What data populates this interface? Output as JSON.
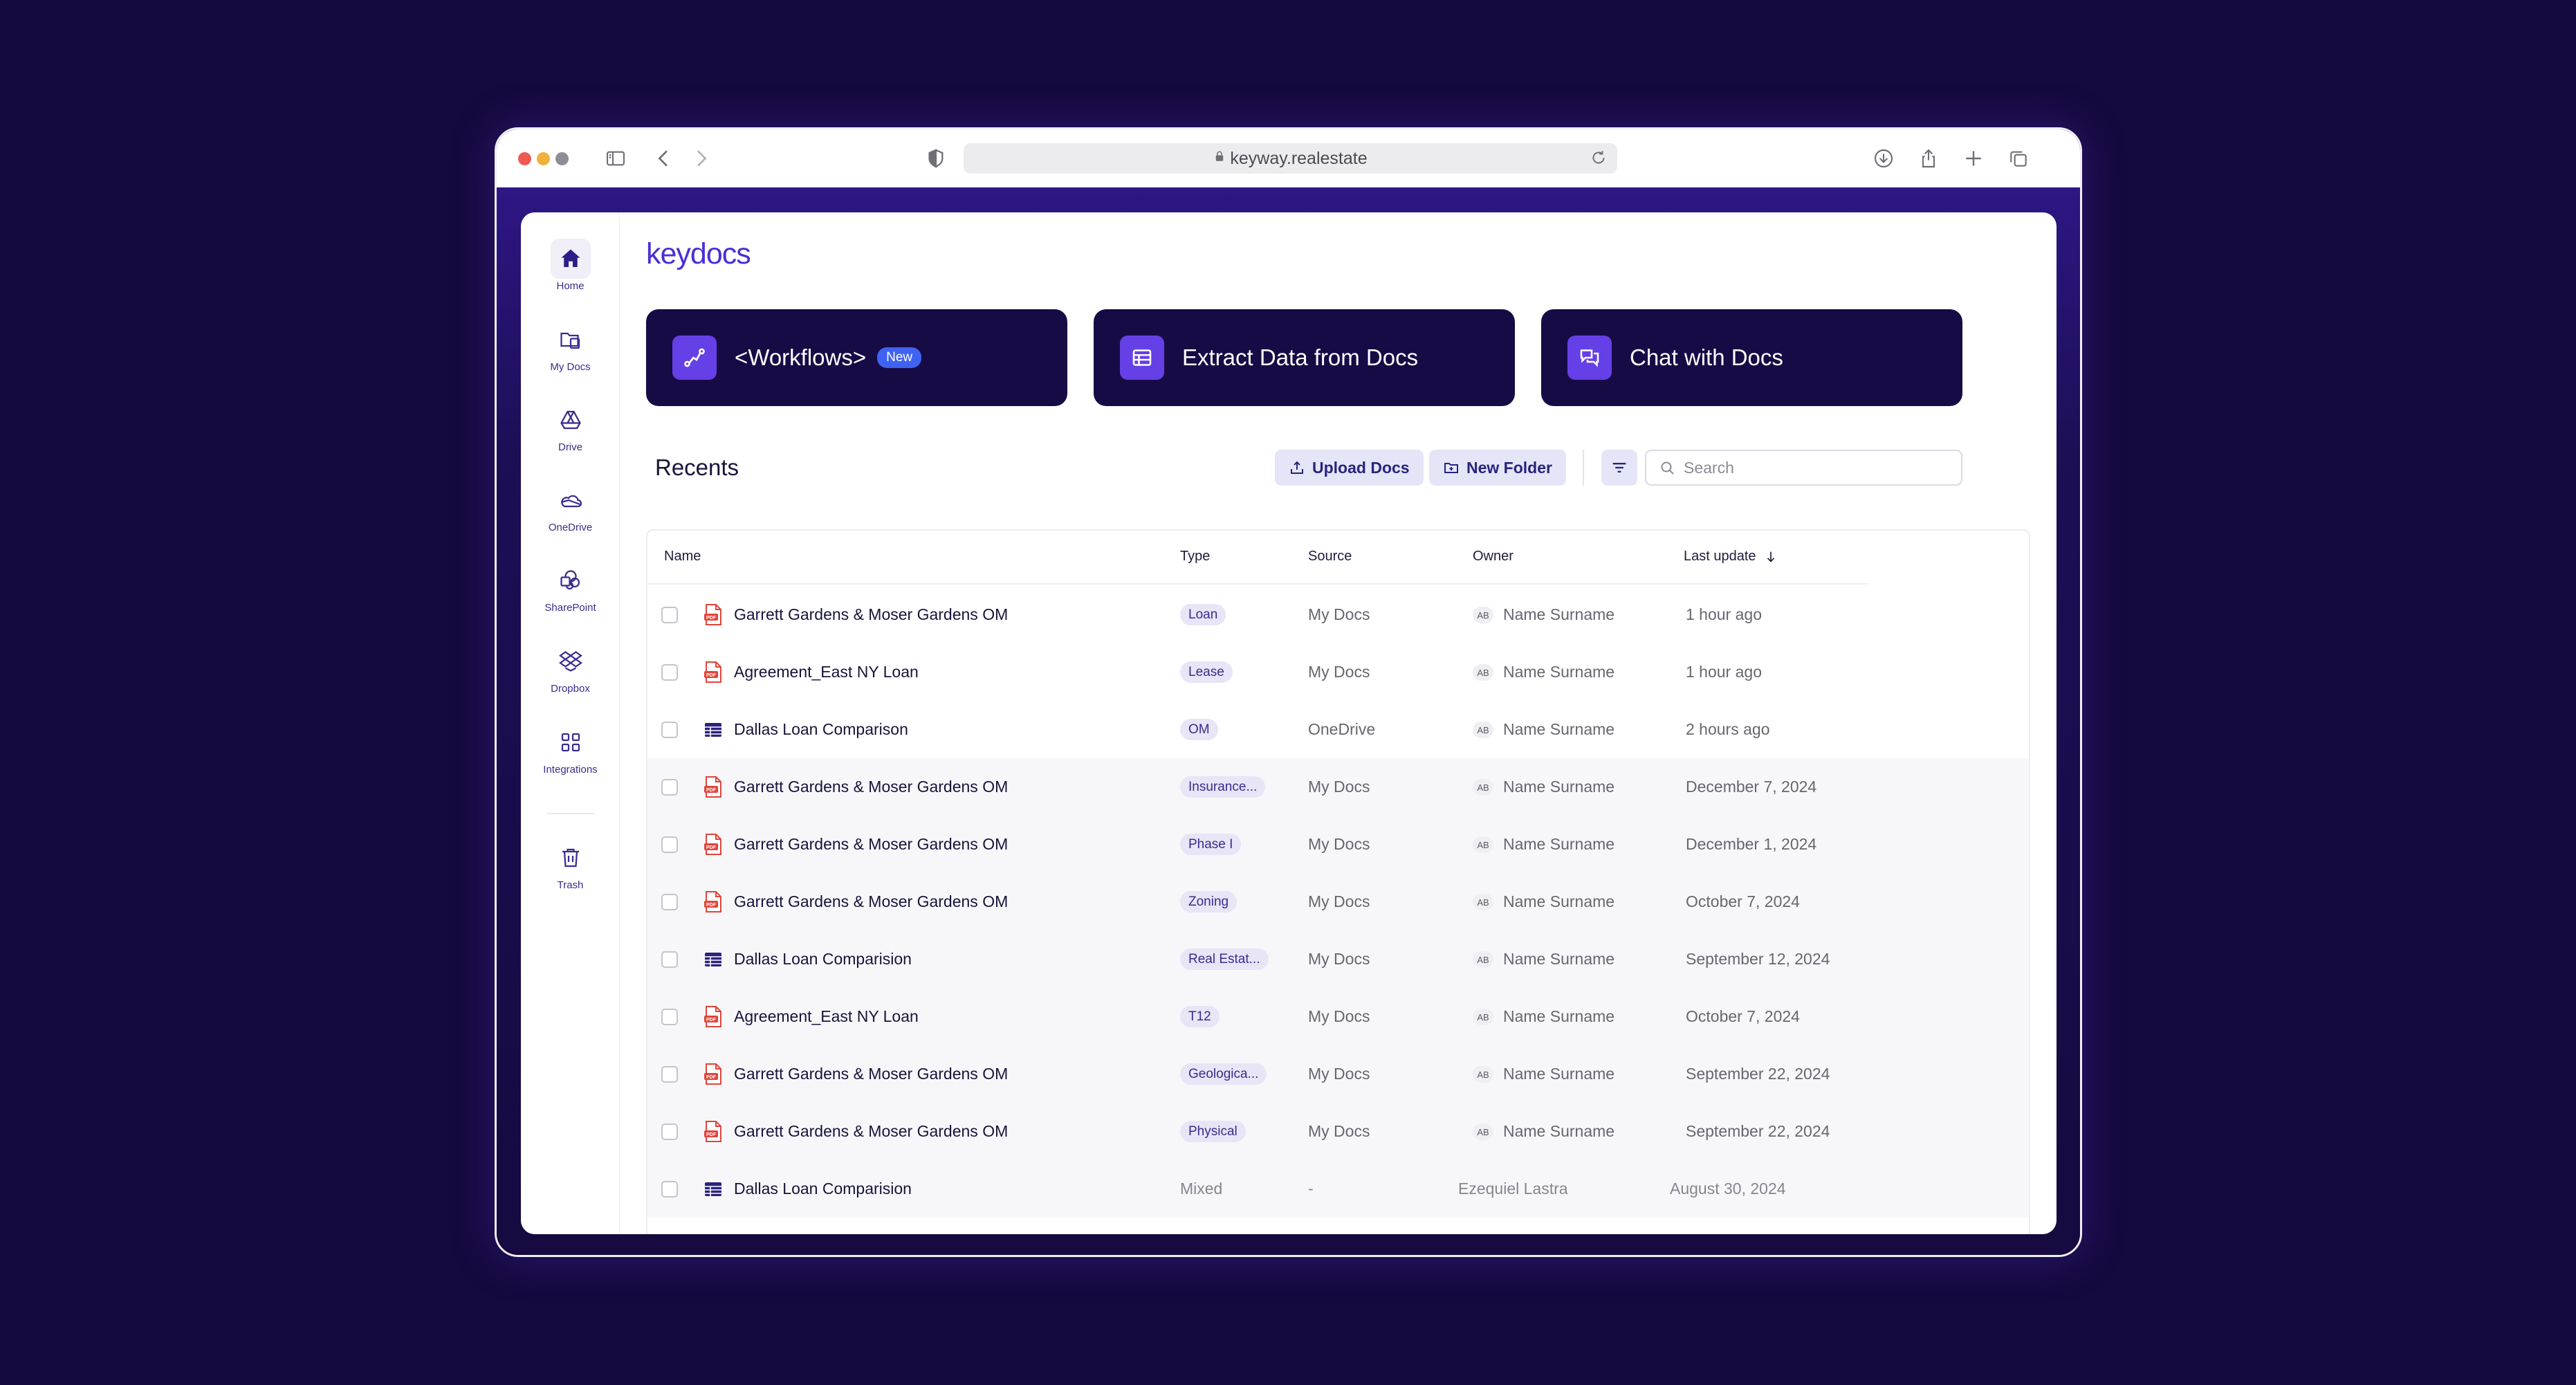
{
  "browser": {
    "url": "keyway.realestate"
  },
  "app": {
    "logo": "keydocs"
  },
  "sidebar": {
    "items": [
      {
        "label": "Home",
        "icon": "home-icon"
      },
      {
        "label": "My Docs",
        "icon": "my-docs-icon"
      },
      {
        "label": "Drive",
        "icon": "drive-icon"
      },
      {
        "label": "OneDrive",
        "icon": "onedrive-icon"
      },
      {
        "label": "SharePoint",
        "icon": "sharepoint-icon"
      },
      {
        "label": "Dropbox",
        "icon": "dropbox-icon"
      },
      {
        "label": "Integrations",
        "icon": "integrations-icon"
      },
      {
        "label": "Trash",
        "icon": "trash-icon"
      }
    ]
  },
  "cards": [
    {
      "title": "<Workflows>",
      "badge": "New",
      "icon": "workflow-icon"
    },
    {
      "title": "Extract Data from Docs",
      "icon": "table-icon"
    },
    {
      "title": "Chat with Docs",
      "icon": "chat-icon"
    }
  ],
  "recents": {
    "title": "Recents",
    "upload_label": "Upload Docs",
    "new_folder_label": "New Folder",
    "search_placeholder": "Search"
  },
  "table": {
    "columns": [
      "Name",
      "Type",
      "Source",
      "Owner",
      "Last update"
    ],
    "rows": [
      {
        "name": "Garrett Gardens & Moser Gardens OM",
        "file": "pdf",
        "type": "Loan",
        "source": "My Docs",
        "initials": "AB",
        "owner": "Name Surname",
        "updated": "1 hour ago"
      },
      {
        "name": "Agreement_East NY Loan",
        "file": "pdf",
        "type": "Lease",
        "source": "My Docs",
        "initials": "AB",
        "owner": "Name Surname",
        "updated": "1 hour ago"
      },
      {
        "name": "Dallas Loan Comparison",
        "file": "sheet",
        "type": "OM",
        "source": "OneDrive",
        "initials": "AB",
        "owner": "Name Surname",
        "updated": "2 hours ago"
      },
      {
        "name": "Garrett Gardens & Moser Gardens OM",
        "file": "pdf",
        "type": "Insurance...",
        "source": "My Docs",
        "initials": "AB",
        "owner": "Name Surname",
        "updated": "December 7, 2024"
      },
      {
        "name": "Garrett Gardens & Moser Gardens OM",
        "file": "pdf",
        "type": "Phase I",
        "source": "My Docs",
        "initials": "AB",
        "owner": "Name Surname",
        "updated": "December 1, 2024"
      },
      {
        "name": "Garrett Gardens & Moser Gardens OM",
        "file": "pdf",
        "type": "Zoning",
        "source": "My Docs",
        "initials": "AB",
        "owner": "Name Surname",
        "updated": "October 7, 2024"
      },
      {
        "name": "Dallas Loan Comparision",
        "file": "sheet",
        "type": "Real Estat...",
        "source": "My Docs",
        "initials": "AB",
        "owner": "Name Surname",
        "updated": "September 12, 2024"
      },
      {
        "name": "Agreement_East NY Loan",
        "file": "pdf",
        "type": "T12",
        "source": "My Docs",
        "initials": "AB",
        "owner": "Name Surname",
        "updated": "October 7, 2024"
      },
      {
        "name": "Garrett Gardens & Moser Gardens OM",
        "file": "pdf",
        "type": "Geologica...",
        "source": "My Docs",
        "initials": "AB",
        "owner": "Name Surname",
        "updated": "September 22, 2024"
      },
      {
        "name": "Garrett Gardens & Moser Gardens OM",
        "file": "pdf",
        "type": "Physical",
        "source": "My Docs",
        "initials": "AB",
        "owner": "Name Surname",
        "updated": "September 22, 2024"
      },
      {
        "name": "Dallas Loan Comparision",
        "file": "sheet",
        "type": "Mixed",
        "source": "-",
        "initials": "",
        "owner": "Ezequiel Lastra",
        "updated": "August 30, 2024"
      }
    ]
  },
  "colors": {
    "background": "#16093f",
    "card": "#170b46",
    "accent": "#6440e6",
    "logo": "#4b2ed6",
    "pdf": "#e0443c",
    "sheet": "#2a237e"
  }
}
